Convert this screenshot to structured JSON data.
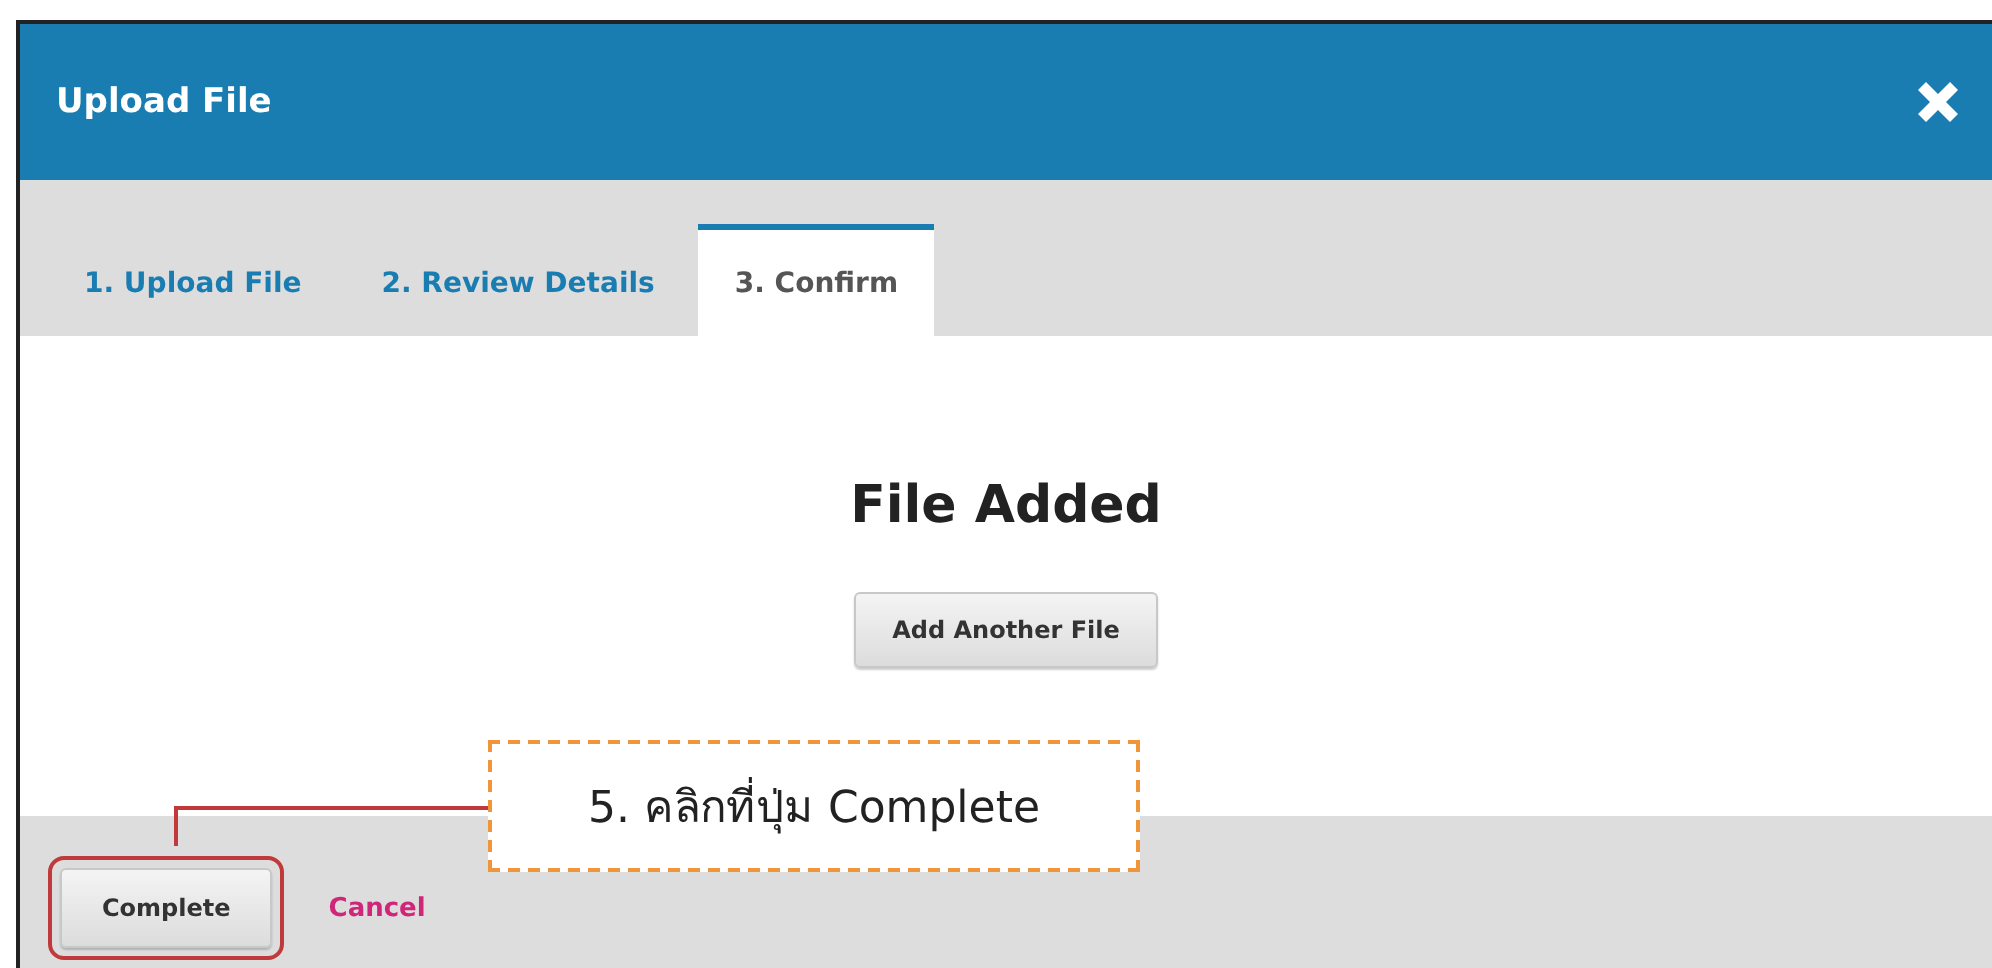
{
  "dialog": {
    "title": "Upload File"
  },
  "tabs": [
    {
      "label": "1. Upload File",
      "selected": false
    },
    {
      "label": "2. Review Details",
      "selected": false
    },
    {
      "label": "3. Confirm",
      "selected": true
    }
  ],
  "body": {
    "heading": "File Added",
    "button": "Add Another File"
  },
  "footer": {
    "primary": "Complete",
    "cancel": "Cancel"
  },
  "annotation": {
    "text": "5. คลิกที่ปุ่ม Complete"
  }
}
